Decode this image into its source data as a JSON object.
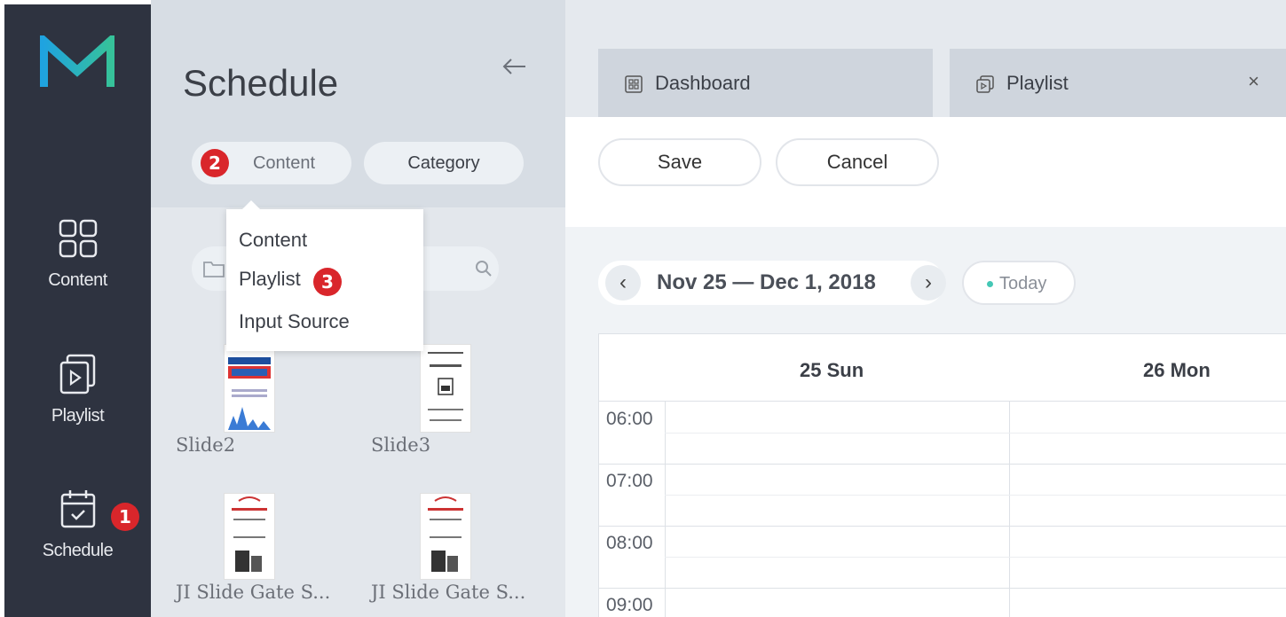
{
  "app": {
    "brand_colors": {
      "rail": "#2e3340",
      "accent_badge": "#d9262b",
      "today_dot": "#44c7b5"
    }
  },
  "rail": {
    "items": [
      {
        "label": "Content",
        "icon": "grid-icon"
      },
      {
        "label": "Playlist",
        "icon": "playlist-icon"
      },
      {
        "label": "Schedule",
        "icon": "calendar-icon"
      }
    ],
    "badge_schedule": "1"
  },
  "panel": {
    "title": "Schedule",
    "filter_content": "Content",
    "filter_category": "Category",
    "badge_content": "2",
    "dropdown": {
      "options": [
        "Content",
        "Playlist",
        "Input Source"
      ],
      "badge_playlist": "3"
    },
    "thumbs": [
      {
        "label": "Slide2"
      },
      {
        "label": "Slide3"
      },
      {
        "label": "JI Slide Gate S..."
      },
      {
        "label": "JI Slide Gate S..."
      }
    ]
  },
  "tabs": [
    {
      "label": "Dashboard",
      "icon": "dashboard-icon"
    },
    {
      "label": "Playlist",
      "icon": "playlist-tab-icon",
      "close": "×"
    }
  ],
  "toolbar": {
    "save_label": "Save",
    "cancel_label": "Cancel"
  },
  "calendar": {
    "range": "Nov 25 — Dec 1, 2018",
    "today_label": "Today",
    "days": [
      "25 Sun",
      "26 Mon"
    ],
    "times": [
      "06:00",
      "07:00",
      "08:00",
      "09:00"
    ]
  }
}
